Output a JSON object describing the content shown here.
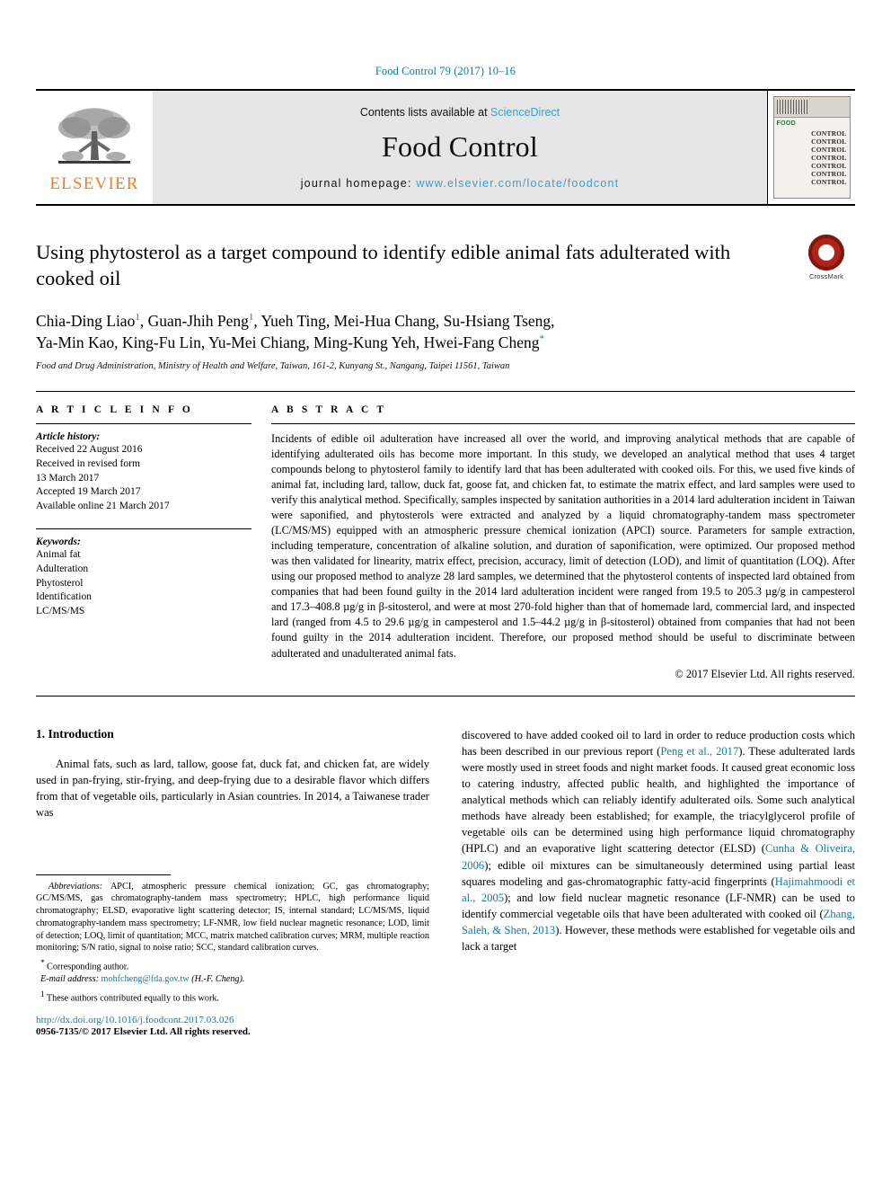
{
  "running_head": "Food Control 79 (2017) 10–16",
  "masthead": {
    "publisher": "ELSEVIER",
    "contents_prefix": "Contents lists available at ",
    "contents_link": "ScienceDirect",
    "journal_title": "Food Control",
    "homepage_prefix": "journal homepage: ",
    "homepage_url": "www.elsevier.com/locate/foodcont",
    "cover_food_label": "FOOD",
    "cover_lines": [
      "CONTROL",
      "CONTROL",
      "CONTROL",
      "CONTROL",
      "CONTROL",
      "CONTROL",
      "CONTROL"
    ]
  },
  "article": {
    "title": "Using phytosterol as a target compound to identify edible animal fats adulterated with cooked oil",
    "crossmark_label": "CrossMark",
    "authors_line1": "Chia-Ding Liao",
    "authors_rest1": ", Guan-Jhih Peng",
    "authors_rest2": ", Yueh Ting, Mei-Hua Chang, Su-Hsiang Tseng,",
    "authors_line2": "Ya-Min Kao, King-Fu Lin, Yu-Mei Chiang, Ming-Kung Yeh, Hwei-Fang Cheng",
    "author_mark_1": "1",
    "author_mark_star": "*",
    "affiliation": "Food and Drug Administration, Ministry of Health and Welfare, Taiwan, 161-2, Kunyang St., Nangang, Taipei 11561, Taiwan"
  },
  "article_info": {
    "heading": "A R T I C L E   I N F O",
    "history_label": "Article history:",
    "history": [
      "Received 22 August 2016",
      "Received in revised form",
      "13 March 2017",
      "Accepted 19 March 2017",
      "Available online 21 March 2017"
    ],
    "keywords_label": "Keywords:",
    "keywords": [
      "Animal fat",
      "Adulteration",
      "Phytosterol",
      "Identification",
      "LC/MS/MS"
    ]
  },
  "abstract": {
    "heading": "A B S T R A C T",
    "text": "Incidents of edible oil adulteration have increased all over the world, and improving analytical methods that are capable of identifying adulterated oils has become more important. In this study, we developed an analytical method that uses 4 target compounds belong to phytosterol family to identify lard that has been adulterated with cooked oils. For this, we used five kinds of animal fat, including lard, tallow, duck fat, goose fat, and chicken fat, to estimate the matrix effect, and lard samples were used to verify this analytical method. Specifically, samples inspected by sanitation authorities in a 2014 lard adulteration incident in Taiwan were saponified, and phytosterols were extracted and analyzed by a liquid chromatography-tandem mass spectrometer (LC/MS/MS) equipped with an atmospheric pressure chemical ionization (APCI) source. Parameters for sample extraction, including temperature, concentration of alkaline solution, and duration of saponification, were optimized. Our proposed method was then validated for linearity, matrix effect, precision, accuracy, limit of detection (LOD), and limit of quantitation (LOQ). After using our proposed method to analyze 28 lard samples, we determined that the phytosterol contents of inspected lard obtained from companies that had been found guilty in the 2014 lard adulteration incident were ranged from 19.5 to 205.3 µg/g in campesterol and 17.3–408.8 µg/g in β-sitosterol, and were at most 270-fold higher than that of homemade lard, commercial lard, and inspected lard (ranged from 4.5 to 29.6 µg/g in campesterol and 1.5–44.2 µg/g in β-sitosterol) obtained from companies that had not been found guilty in the 2014 adulteration incident. Therefore, our proposed method should be useful to discriminate between adulterated and unadulterated animal fats.",
    "copyright": "© 2017 Elsevier Ltd. All rights reserved."
  },
  "introduction": {
    "heading": "1. Introduction",
    "para_left": "Animal fats, such as lard, tallow, goose fat, duck fat, and chicken fat, are widely used in pan-frying, stir-frying, and deep-frying due to a desirable flavor which differs from that of vegetable oils, particularly in Asian countries. In 2014, a Taiwanese trader was",
    "right_part1": "discovered to have added cooked oil to lard in order to reduce production costs which has been described in our previous report (",
    "right_ref1": "Peng et al., 2017",
    "right_part2": "). These adulterated lards were mostly used in street foods and night market foods. It caused great economic loss to catering industry, affected public health, and highlighted the importance of analytical methods which can reliably identify adulterated oils. Some such analytical methods have already been established; for example, the triacylglycerol profile of vegetable oils can be determined using high performance liquid chromatography (HPLC) and an evaporative light scattering detector (ELSD) (",
    "right_ref2": "Cunha & Oliveira, 2006",
    "right_part3": "); edible oil mixtures can be simultaneously determined using partial least squares modeling and gas-chromatographic fatty-acid fingerprints (",
    "right_ref3": "Hajimahmoodi et al., 2005",
    "right_part4": "); and low field nuclear magnetic resonance (LF-NMR) can be used to identify commercial vegetable oils that have been adulterated with cooked oil (",
    "right_ref4": "Zhang, Saleh, & Shen, 2013",
    "right_part5": "). However, these methods were established for vegetable oils and lack a target"
  },
  "footnotes": {
    "abbrev_label": "Abbreviations:",
    "abbrev_text": " APCI, atmospheric pressure chemical ionization; GC, gas chromatography; GC/MS/MS, gas chromatography-tandem mass spectrometry; HPLC, high performance liquid chromatography; ELSD, evaporative light scattering detector; IS, internal standard; LC/MS/MS, liquid chromatography-tandem mass spectrometry; LF-NMR, low field nuclear magnetic resonance; LOD, limit of detection; LOQ, limit of quantitation; MCC, matrix matched calibration curves; MRM, multiple reaction monitoring; S/N ratio, signal to noise ratio; SCC, standard calibration curves.",
    "corresponding_mark": "*",
    "corresponding_text": "Corresponding author.",
    "email_label": "E-mail address:",
    "email_address": " mohfcheng@fda.gov.tw",
    "email_suffix": " (H.-F. Cheng).",
    "equal_mark": "1",
    "equal_text": "These authors contributed equally to this work."
  },
  "footer": {
    "doi": "http://dx.doi.org/10.1016/j.foodcont.2017.03.026",
    "issn_line": "0956-7135/© 2017 Elsevier Ltd. All rights reserved."
  },
  "colors": {
    "link": "#1178a8",
    "sciencedirect": "#3aa0d1",
    "elsevier_orange": "#ef7d22",
    "crossmark_red": "#b02318"
  }
}
